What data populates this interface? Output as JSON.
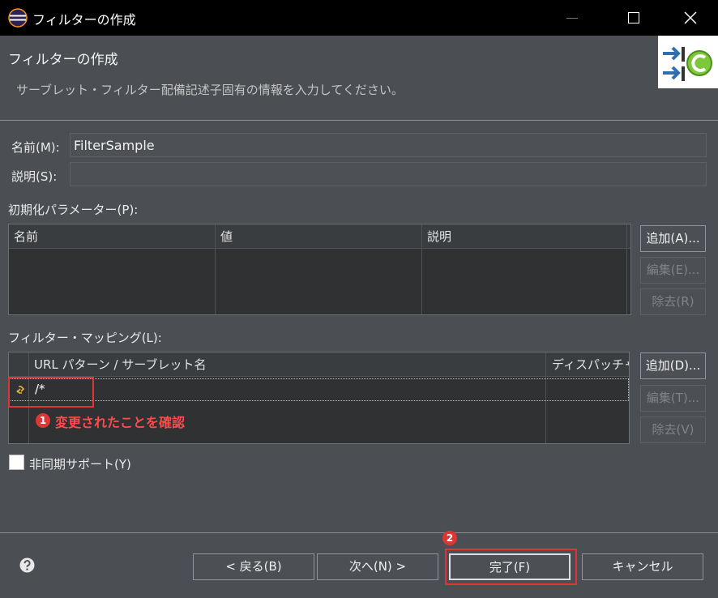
{
  "window": {
    "title": "フィルターの作成"
  },
  "header": {
    "title": "フィルターの作成",
    "message": "サーブレット・フィルター配備記述子固有の情報を入力してください。"
  },
  "form": {
    "name_label": "名前(M):",
    "name_value": "FilterSample",
    "description_label": "説明(S):",
    "description_value": ""
  },
  "init_params": {
    "label": "初期化パラメーター(P):",
    "columns": [
      "名前",
      "値",
      "説明"
    ],
    "add_label": "追加(A)...",
    "edit_label": "編集(E)...",
    "remove_label": "除去(R)"
  },
  "filter_mappings": {
    "label": "フィルター・マッピング(L):",
    "columns": [
      "URL パターン / サーブレット名",
      "ディスパッチャ"
    ],
    "rows": [
      {
        "pattern": "/*",
        "dispatcher": ""
      }
    ],
    "add_label": "追加(D)...",
    "edit_label": "編集(T)...",
    "remove_label": "除去(V)"
  },
  "async_support": {
    "label": "非同期サポート(Y)",
    "checked": false
  },
  "footer": {
    "back_label": "< 戻る(B)",
    "next_label": "次へ(N) >",
    "finish_label": "完了(F)",
    "cancel_label": "キャンセル"
  },
  "annotations": {
    "badge_1": "1",
    "text_1": "変更されたことを確認",
    "badge_2": "2",
    "color": "#e03535"
  },
  "icons": {
    "app": "eclipse-icon",
    "banner": "filter-wizard-banner-icon",
    "mapping_row": "mapping-url-icon",
    "help": "help-icon"
  },
  "colors": {
    "background": "#4b4f53",
    "titlebar": "#000000",
    "table_background": "#2f3133",
    "annotation": "#e03535"
  }
}
